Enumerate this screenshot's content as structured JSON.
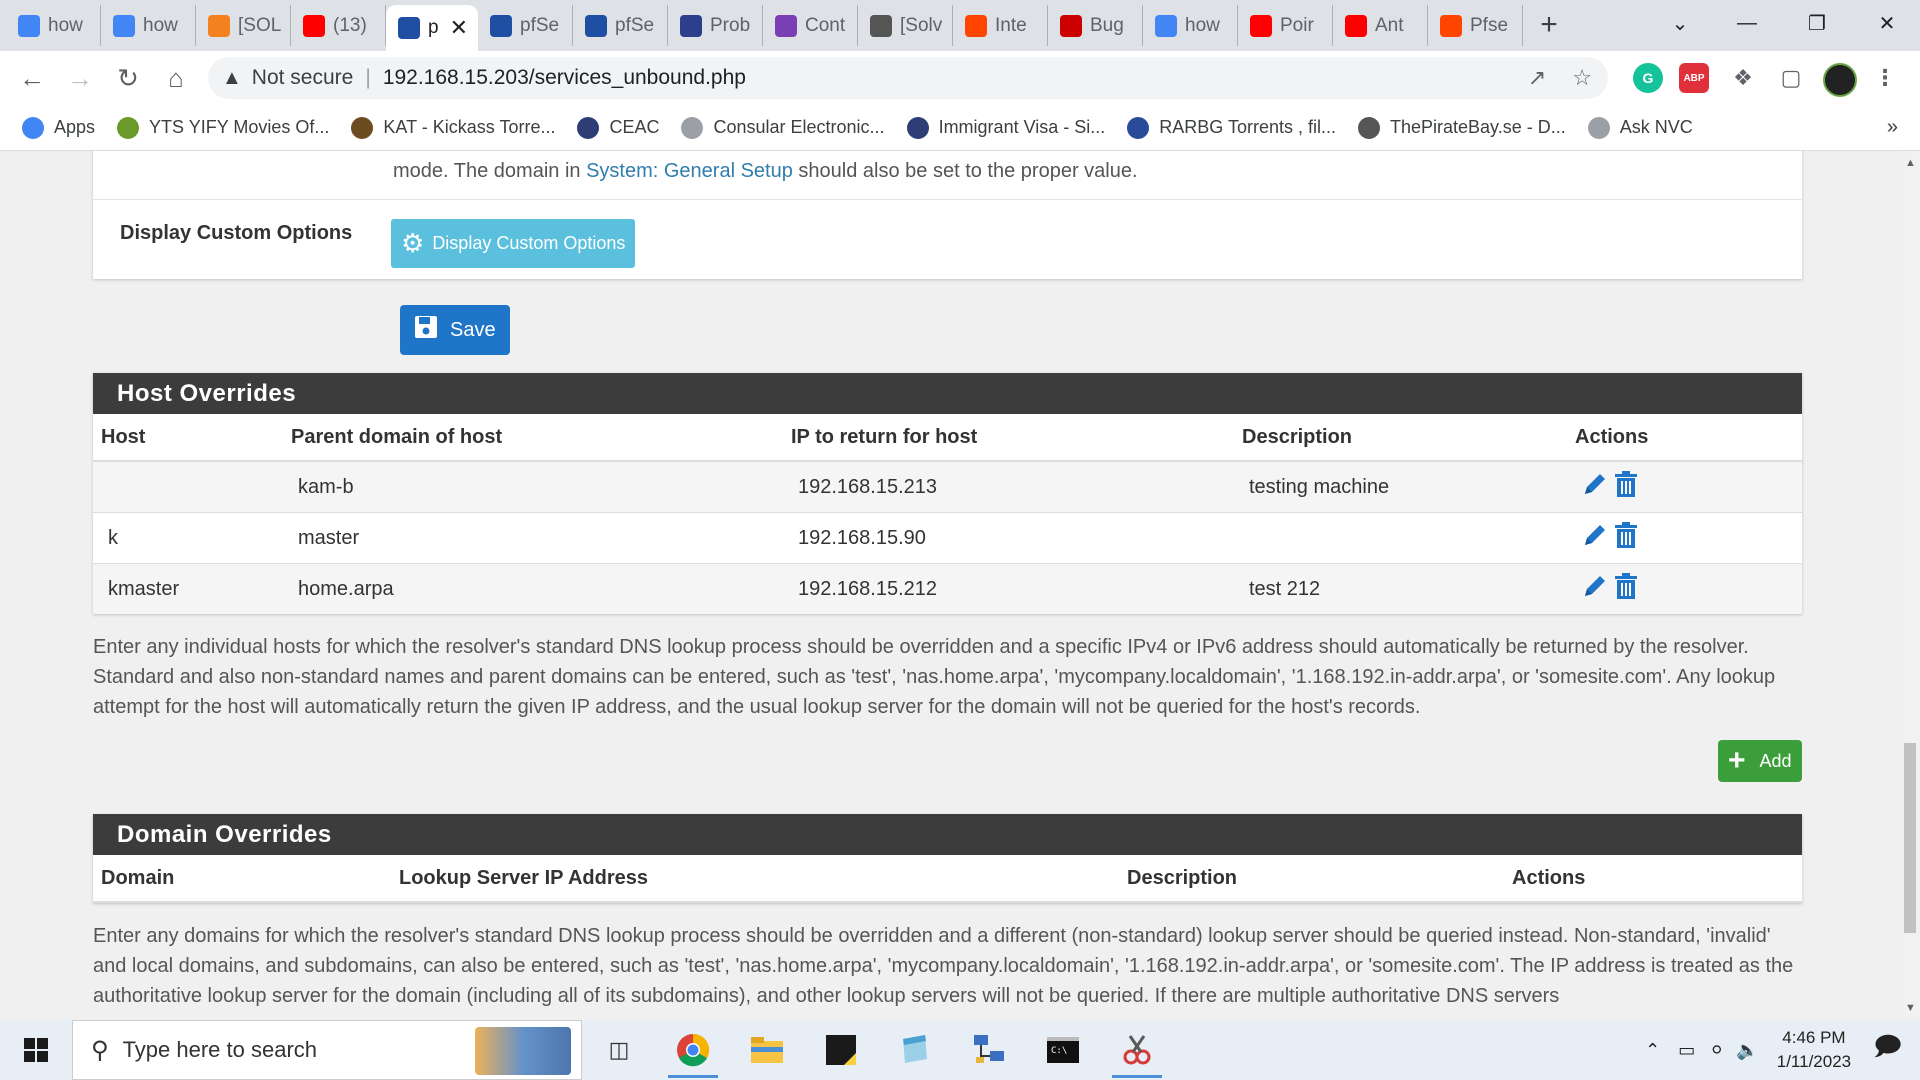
{
  "browser": {
    "tabs": [
      {
        "title": "how",
        "icon": "google-icon",
        "color": "#4285f4"
      },
      {
        "title": "how",
        "icon": "google-icon",
        "color": "#4285f4"
      },
      {
        "title": "[SOL",
        "icon": "solved-icon",
        "color": "#f4811f"
      },
      {
        "title": "(13)",
        "icon": "youtube-icon",
        "color": "#ff0000"
      },
      {
        "title": "p",
        "icon": "pfsense-icon",
        "color": "#1e4fa3",
        "active": true
      },
      {
        "title": "pfSe",
        "icon": "pfsense-icon",
        "color": "#1e4fa3"
      },
      {
        "title": "pfSe",
        "icon": "pfsense-icon",
        "color": "#1e4fa3"
      },
      {
        "title": "Prob",
        "icon": "netgate-icon",
        "color": "#2c3e8c"
      },
      {
        "title": "Cont",
        "icon": "purple-icon",
        "color": "#7b3fb5"
      },
      {
        "title": "[Solv",
        "icon": "doc-icon",
        "color": "#555555"
      },
      {
        "title": "Inte",
        "icon": "reddit-icon",
        "color": "#ff4500"
      },
      {
        "title": "Bug",
        "icon": "redhat-icon",
        "color": "#cc0000"
      },
      {
        "title": "how",
        "icon": "google-icon",
        "color": "#4285f4"
      },
      {
        "title": "Poir",
        "icon": "youtube-icon",
        "color": "#ff0000"
      },
      {
        "title": "Ant",
        "icon": "youtube-icon",
        "color": "#ff0000"
      },
      {
        "title": "Pfse",
        "icon": "reddit-icon",
        "color": "#ff4500"
      }
    ],
    "security_label": "Not secure",
    "url": "192.168.15.203/services_unbound.php",
    "bookmarks": [
      {
        "label": "Apps",
        "icon": "apps-grid-icon"
      },
      {
        "label": "YTS YIFY Movies Of...",
        "icon": "yts-icon"
      },
      {
        "label": "KAT - Kickass Torre...",
        "icon": "kat-icon"
      },
      {
        "label": "CEAC",
        "icon": "seal-icon"
      },
      {
        "label": "Consular Electronic...",
        "icon": "loading-icon"
      },
      {
        "label": "Immigrant Visa - Si...",
        "icon": "seal-icon"
      },
      {
        "label": "RARBG Torrents , fil...",
        "icon": "rarbg-icon"
      },
      {
        "label": "ThePirateBay.se - D...",
        "icon": "globe-icon"
      },
      {
        "label": "Ask NVC",
        "icon": "loading-icon"
      }
    ]
  },
  "page": {
    "top_help_text": "mode. The domain in ",
    "top_help_link": "System: General Setup",
    "top_help_tail": " should also be set to the proper value.",
    "custom_options_label": "Display Custom Options",
    "custom_options_button": "Display Custom Options",
    "save_button": "Save",
    "host_overrides": {
      "title": "Host Overrides",
      "columns": [
        "Host",
        "Parent domain of host",
        "IP to return for host",
        "Description",
        "Actions"
      ],
      "rows": [
        {
          "host": "",
          "domain": "kam-b",
          "ip": "192.168.15.213",
          "description": "testing machine"
        },
        {
          "host": "k",
          "domain": "master",
          "ip": "192.168.15.90",
          "description": ""
        },
        {
          "host": "kmaster",
          "domain": "home.arpa",
          "ip": "192.168.15.212",
          "description": "test 212"
        }
      ],
      "help_text": "Enter any individual hosts for which the resolver's standard DNS lookup process should be overridden and a specific IPv4 or IPv6 address should automatically be returned by the resolver. Standard and also non-standard names and parent domains can be entered, such as 'test', 'nas.home.arpa', 'mycompany.localdomain', '1.168.192.in-addr.arpa', or 'somesite.com'. Any lookup attempt for the host will automatically return the given IP address, and the usual lookup server for the domain will not be queried for the host's records.",
      "add_button": "Add"
    },
    "domain_overrides": {
      "title": "Domain Overrides",
      "columns": [
        "Domain",
        "Lookup Server IP Address",
        "Description",
        "Actions"
      ],
      "help_text": "Enter any domains for which the resolver's standard DNS lookup process should be overridden and a different (non-standard) lookup server should be queried instead. Non-standard, 'invalid' and local domains, and subdomains, can also be entered, such as 'test', 'nas.home.arpa', 'mycompany.localdomain', '1.168.192.in-addr.arpa', or 'somesite.com'. The IP address is treated as the authoritative lookup server for the domain (including all of its subdomains), and other lookup servers will not be queried. If there are multiple authoritative DNS servers"
    }
  },
  "taskbar": {
    "search_placeholder": "Type here to search",
    "time": "4:46 PM",
    "date": "1/11/2023"
  },
  "colors": {
    "panel_heading": "#3c3c3c",
    "link": "#317eac",
    "info_button": "#5bc0de",
    "primary_button": "#1f76c8",
    "success_button": "#3c9e3a",
    "action_icon": "#1f76c8"
  }
}
